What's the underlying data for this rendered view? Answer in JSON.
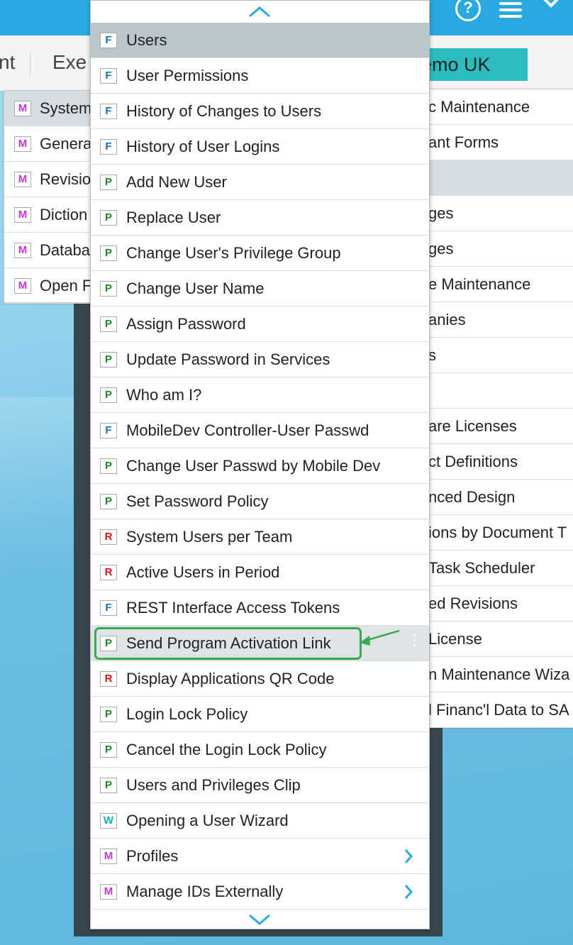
{
  "topbar": {
    "help_icon": "help-circle-icon",
    "help_glyph": "?",
    "menu_icon": "hamburger-menu-icon",
    "dropdown_icon": "chevron-down-icon",
    "color": "#29a9e1"
  },
  "secondary_bar": {
    "left_text": "nt",
    "exec_text": "Exe",
    "company": "emo UK",
    "company_color": "#2bbdbd"
  },
  "left_menu": {
    "items": [
      {
        "type": "M",
        "label": "System"
      },
      {
        "type": "M",
        "label": "General"
      },
      {
        "type": "M",
        "label": "Revision"
      },
      {
        "type": "M",
        "label": "Diction"
      },
      {
        "type": "M",
        "label": "Databa"
      },
      {
        "type": "M",
        "label": "Open F"
      }
    ]
  },
  "right_menu": {
    "items": [
      {
        "label": "c Maintenance"
      },
      {
        "label": "ant Forms"
      },
      {
        "label": ""
      },
      {
        "label": "ges"
      },
      {
        "label": "ges"
      },
      {
        "label": "e Maintenance"
      },
      {
        "label": "anies"
      },
      {
        "label": "s"
      },
      {
        "label": ""
      },
      {
        "label": "are Licenses"
      },
      {
        "label": "ct Definitions"
      },
      {
        "label": "nced Design"
      },
      {
        "label": "ions by Document T"
      },
      {
        "label": "Task Scheduler"
      },
      {
        "label": "ed Revisions"
      },
      {
        "label": "License"
      },
      {
        "label": "n Maintenance Wiza"
      },
      {
        "label": "l Financ'l Data to SA"
      }
    ]
  },
  "dropdown": {
    "scroll_up_icon": "chevron-up-icon",
    "scroll_down_icon": "chevron-down-icon",
    "items": [
      {
        "type": "F",
        "label": "Users"
      },
      {
        "type": "F",
        "label": "User Permissions"
      },
      {
        "type": "F",
        "label": "History of Changes to Users"
      },
      {
        "type": "F",
        "label": "History of User Logins"
      },
      {
        "type": "P",
        "label": "Add New User"
      },
      {
        "type": "P",
        "label": "Replace User"
      },
      {
        "type": "P",
        "label": "Change User's Privilege Group"
      },
      {
        "type": "P",
        "label": "Change User Name"
      },
      {
        "type": "P",
        "label": "Assign Password"
      },
      {
        "type": "P",
        "label": "Update Password in Services"
      },
      {
        "type": "P",
        "label": "Who am I?"
      },
      {
        "type": "F",
        "label": "MobileDev Controller-User Passwd"
      },
      {
        "type": "P",
        "label": "Change User Passwd by Mobile Dev"
      },
      {
        "type": "P",
        "label": "Set Password Policy"
      },
      {
        "type": "R",
        "label": "System Users per Team"
      },
      {
        "type": "R",
        "label": "Active Users in Period"
      },
      {
        "type": "F",
        "label": "REST Interface Access Tokens"
      },
      {
        "type": "P",
        "label": "Send Program Activation Link"
      },
      {
        "type": "R",
        "label": "Display Applications QR Code"
      },
      {
        "type": "P",
        "label": "Login Lock Policy"
      },
      {
        "type": "P",
        "label": "Cancel the Login Lock Policy"
      },
      {
        "type": "P",
        "label": "Users and Privileges Clip"
      },
      {
        "type": "W",
        "label": "Opening a User Wizard"
      },
      {
        "type": "M",
        "label": "Profiles"
      },
      {
        "type": "M",
        "label": "Manage IDs Externally"
      }
    ]
  },
  "colors": {
    "F": "#1a6fb5",
    "P": "#1e8a25",
    "R": "#d11616",
    "M": "#c43ad6",
    "W": "#18aab5",
    "highlight": "#3aa94f",
    "selected_row": "#b9c7cc"
  }
}
